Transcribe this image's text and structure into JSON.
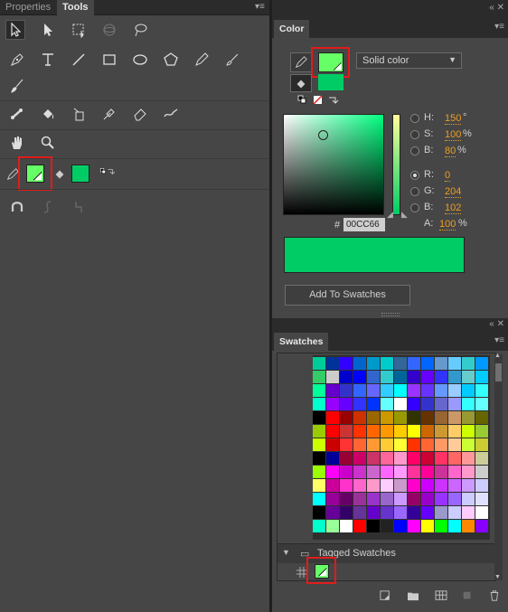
{
  "tools_panel": {
    "tabs": [
      {
        "label": "Properties"
      },
      {
        "label": "Tools"
      }
    ],
    "fill_color": "#66ff66",
    "stroke_color": "#00cc66"
  },
  "color_panel": {
    "title": "Color",
    "fill_type": "Solid color",
    "h": {
      "label": "H:",
      "value": "150",
      "unit": "°"
    },
    "s": {
      "label": "S:",
      "value": "100",
      "unit": "%"
    },
    "b_hsb": {
      "label": "B:",
      "value": "80",
      "unit": "%"
    },
    "r": {
      "label": "R:",
      "value": "0"
    },
    "g": {
      "label": "G:",
      "value": "204"
    },
    "b_rgb": {
      "label": "B:",
      "value": "102"
    },
    "a": {
      "label": "A:",
      "value": "100",
      "unit": "%"
    },
    "hex_label": "#",
    "hex_value": "00CC66",
    "current_color": "#00cc66",
    "fill_swatch": "#66ff66",
    "add_button": "Add To Swatches"
  },
  "swatches_panel": {
    "title": "Swatches",
    "group_label": "Tagged Swatches",
    "tagged_swatch": "#66ff66"
  }
}
